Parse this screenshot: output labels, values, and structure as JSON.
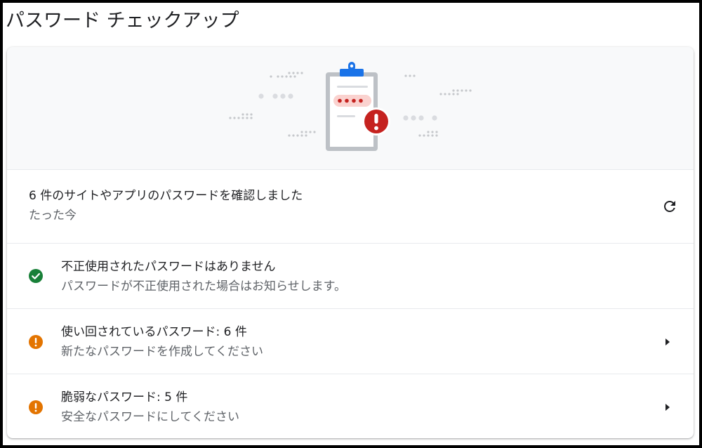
{
  "page": {
    "title": "パスワード チェックアップ"
  },
  "summary": {
    "checked_text": "6 件のサイトやアプリのパスワードを確認しました",
    "timestamp": "たった今",
    "refresh_icon": "refresh-icon"
  },
  "items": [
    {
      "title": "不正使用されたパスワードはありません",
      "subtitle": "パスワードが不正使用された場合はお知らせします。",
      "status": "ok",
      "icon": "check-circle-icon",
      "color": "#188038"
    },
    {
      "title": "使い回されているパスワード: 6 件",
      "subtitle": "新たなパスワードを作成してください",
      "status": "warning",
      "icon": "warning-circle-icon",
      "color": "#e37400"
    },
    {
      "title": "脆弱なパスワード: 5 件",
      "subtitle": "安全なパスワードにしてください",
      "status": "warning",
      "icon": "warning-circle-icon",
      "color": "#e37400"
    }
  ],
  "colors": {
    "alert_red": "#c5221f",
    "brand_blue": "#1a73e8",
    "text_primary": "#202124",
    "text_secondary": "#5f6368"
  }
}
